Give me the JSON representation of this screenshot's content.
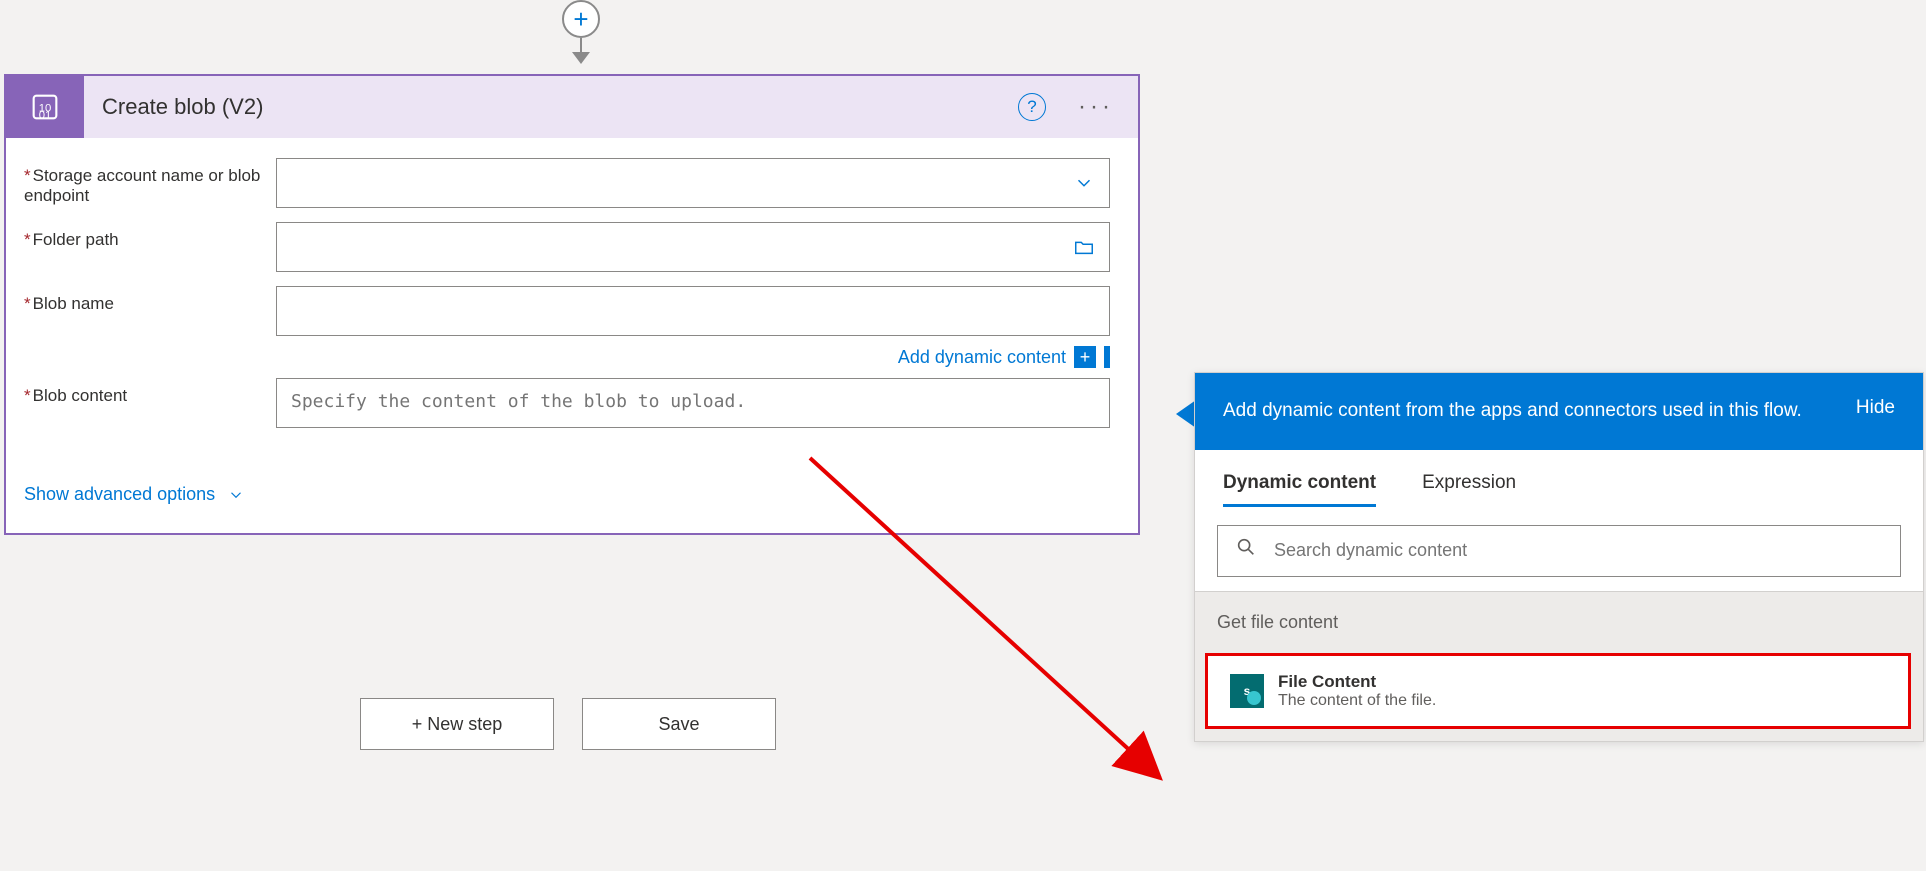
{
  "action": {
    "title": "Create blob (V2)",
    "fields": {
      "storage_label": "Storage account name or blob endpoint",
      "folder_label": "Folder path",
      "blob_name_label": "Blob name",
      "blob_content_label": "Blob content",
      "blob_content_placeholder": "Specify the content of the blob to upload."
    },
    "add_dynamic_content": "Add dynamic content",
    "advanced": "Show advanced options"
  },
  "buttons": {
    "new_step": "+ New step",
    "save": "Save"
  },
  "dynamic_panel": {
    "header": "Add dynamic content from the apps and connectors used in this flow.",
    "hide": "Hide",
    "tabs": {
      "dynamic": "Dynamic content",
      "expression": "Expression"
    },
    "search_placeholder": "Search dynamic content",
    "group_title": "Get file content",
    "item": {
      "title": "File Content",
      "desc": "The content of the file."
    }
  }
}
